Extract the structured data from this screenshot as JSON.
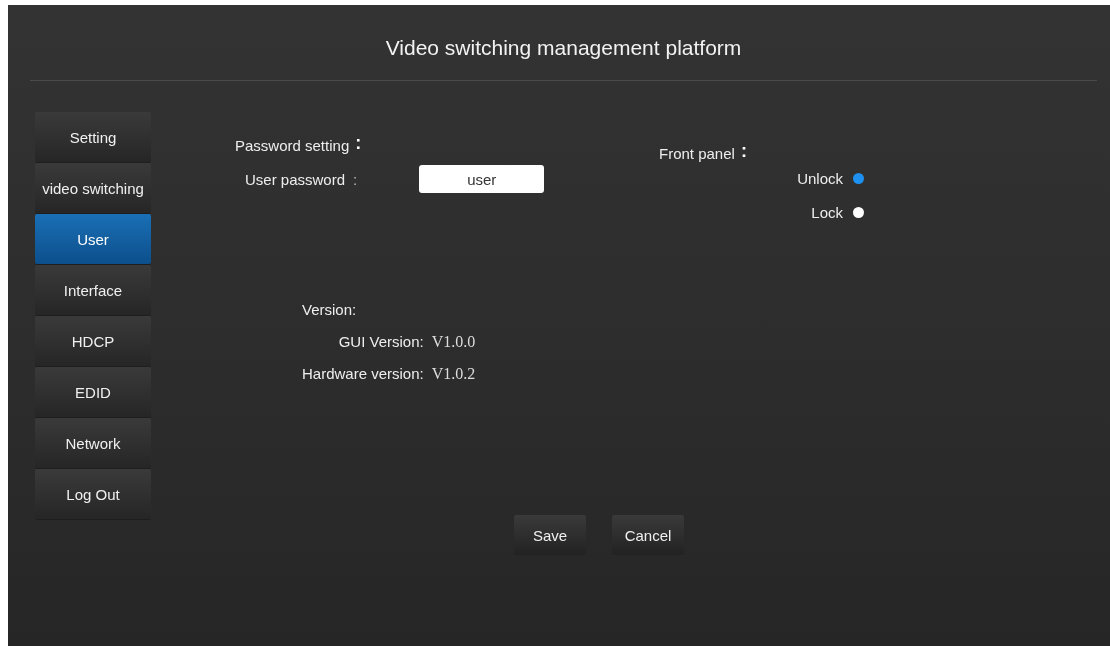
{
  "header": {
    "title": "Video switching management platform"
  },
  "sidebar": {
    "items": [
      {
        "label": "Setting",
        "selected": false
      },
      {
        "label": "video switching",
        "selected": false
      },
      {
        "label": "User",
        "selected": true
      },
      {
        "label": "Interface",
        "selected": false
      },
      {
        "label": "HDCP",
        "selected": false
      },
      {
        "label": "EDID",
        "selected": false
      },
      {
        "label": "Network",
        "selected": false
      },
      {
        "label": "Log Out",
        "selected": false
      }
    ]
  },
  "password": {
    "heading": "Password setting",
    "heading_colon": ":",
    "label": "User password",
    "label_colon": ":",
    "value": "user"
  },
  "front_panel": {
    "heading": "Front panel",
    "heading_colon": ":",
    "options": [
      {
        "label": "Unlock",
        "selected": true
      },
      {
        "label": "Lock",
        "selected": false
      }
    ]
  },
  "version": {
    "heading": "Version:",
    "rows": [
      {
        "label": "GUI Version:",
        "value": "V1.0.0"
      },
      {
        "label": "Hardware version:",
        "value": "V1.0.2"
      }
    ]
  },
  "buttons": [
    "Save",
    "Cancel"
  ]
}
